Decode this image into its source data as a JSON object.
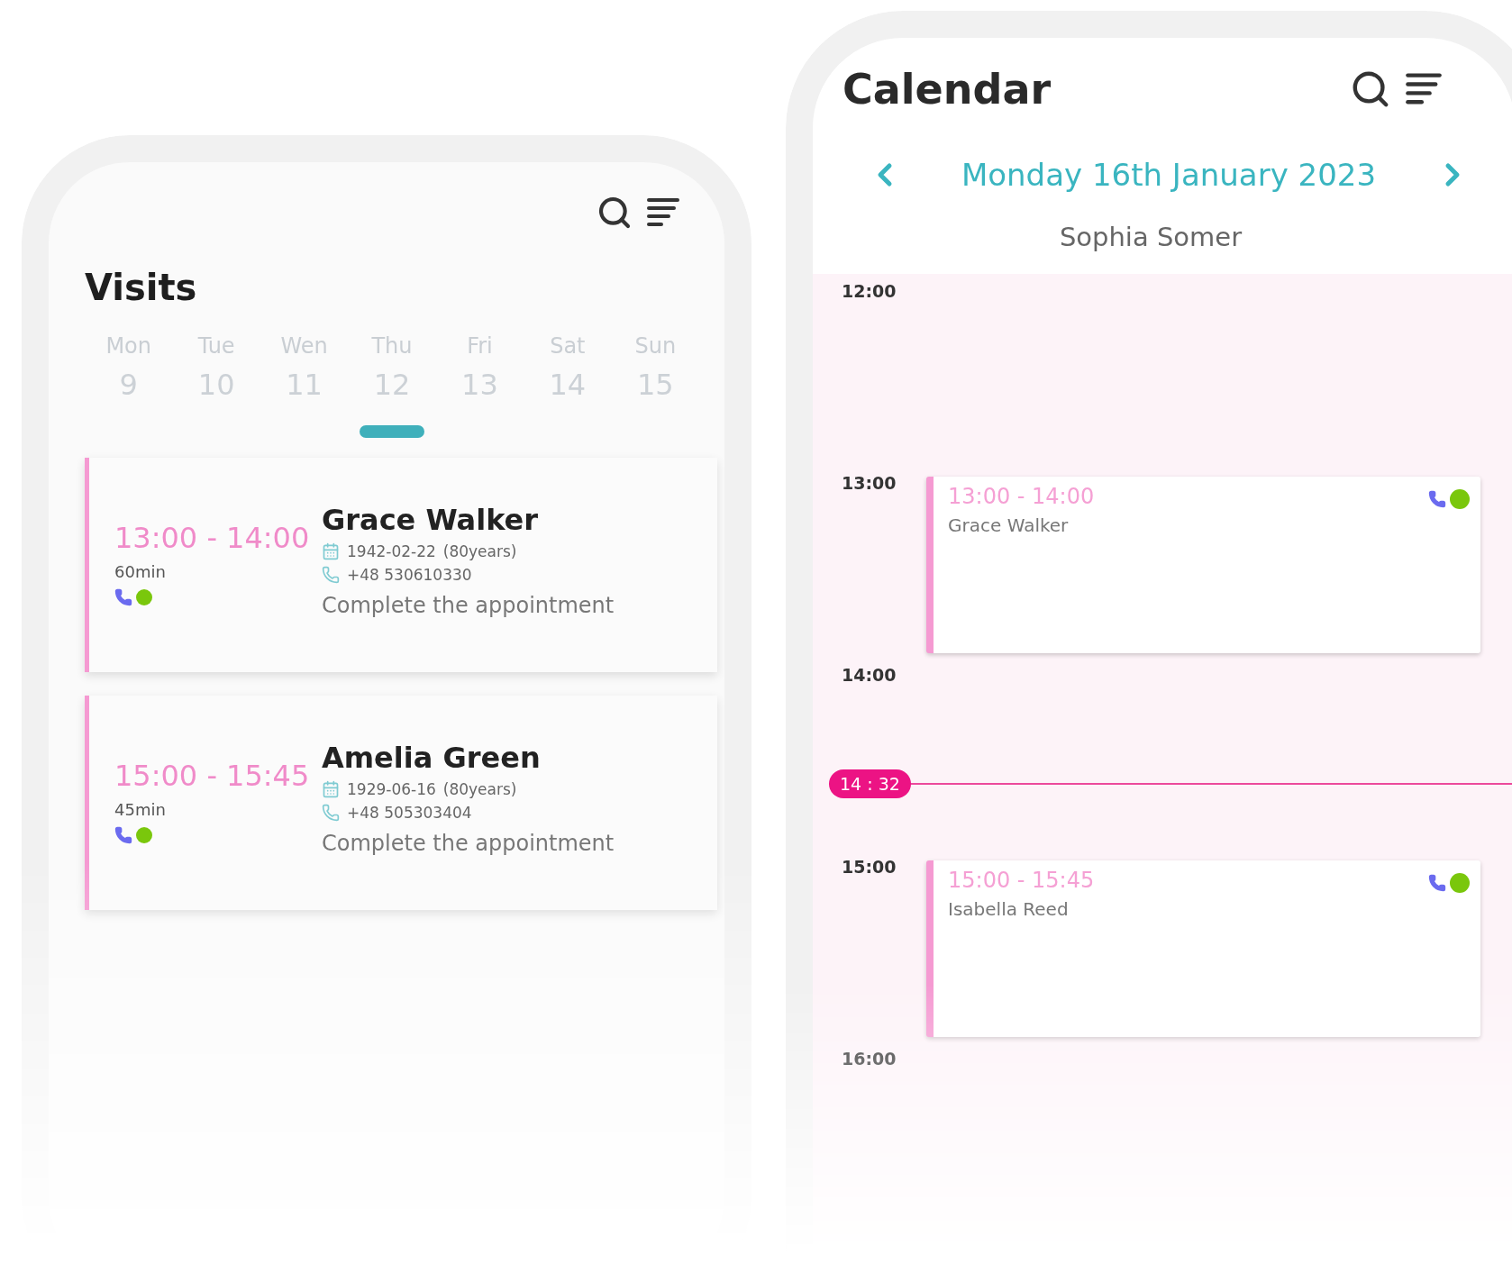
{
  "visits": {
    "title": "Visits",
    "days": [
      {
        "weekday": "Mon",
        "date": "9"
      },
      {
        "weekday": "Tue",
        "date": "10"
      },
      {
        "weekday": "Wen",
        "date": "11"
      },
      {
        "weekday": "Thu",
        "date": "12"
      },
      {
        "weekday": "Fri",
        "date": "13"
      },
      {
        "weekday": "Sat",
        "date": "14"
      },
      {
        "weekday": "Sun",
        "date": "15"
      }
    ],
    "appointments": [
      {
        "time": "13:00 - 14:00",
        "duration": "60min",
        "name": "Grace Walker",
        "birth_date": "1942-02-22",
        "age": "(80years)",
        "phone": "+48 530610330",
        "action": "Complete the appointment"
      },
      {
        "time": "15:00 - 15:45",
        "duration": "45min",
        "name": "Amelia Green",
        "birth_date": "1929-06-16",
        "age": "(80years)",
        "phone": "+48 505303404",
        "action": "Complete the appointment"
      }
    ]
  },
  "calendar": {
    "title": "Calendar",
    "date": "Monday 16th January 2023",
    "person": "Sophia Somer",
    "hours": [
      {
        "label": "12:00"
      },
      {
        "label": "13:00",
        "events": [
          {
            "time": "13:00 - 14:00",
            "name": "Grace Walker"
          }
        ]
      },
      {
        "label": "14:00",
        "now": "14 : 32"
      },
      {
        "label": "15:00",
        "events": [
          {
            "time": "15:00 - 15:45",
            "name": "Isabella Reed"
          }
        ]
      },
      {
        "label": "16:00"
      }
    ]
  }
}
